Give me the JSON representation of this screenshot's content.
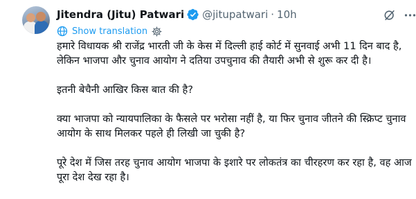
{
  "author": {
    "name": "Jitendra (Jitu) Patwari",
    "handle": "@jitupatwari",
    "separator": "·",
    "time": "10h"
  },
  "icons": {
    "verified": "verified-badge-icon",
    "grok": "grok-icon",
    "more": "more-options-icon",
    "globe": "globe-icon",
    "settings": "gear-icon"
  },
  "colors": {
    "accent": "#1d9bf0",
    "text": "#0f1419",
    "secondary": "#536471"
  },
  "translation": {
    "label": "Show translation"
  },
  "tweet": {
    "paragraphs": [
      "हमारे विधायक श्री राजेंद्र भारती जी के केस में दिल्ली हाई कोर्ट में सुनवाई अभी 11 दिन बाद है, लेकिन भाजपा और चुनाव आयोग ने दतिया उपचुनाव की तैयारी अभी से शुरू कर दी है।",
      "इतनी बेचैनी आखिर किस बात की है?",
      "क्या भाजपा को न्यायपालिका के फैसले पर भरोसा नहीं है, या फिर चुनाव जीतने की स्क्रिप्ट चुनाव आयोग के साथ मिलकर पहले ही लिखी जा चुकी है?",
      "पूरे देश में जिस तरह चुनाव आयोग भाजपा के इशारे पर लोकतंत्र का चीरहरण कर रहा है, वह आज पूरा देश देख रहा है।"
    ]
  }
}
